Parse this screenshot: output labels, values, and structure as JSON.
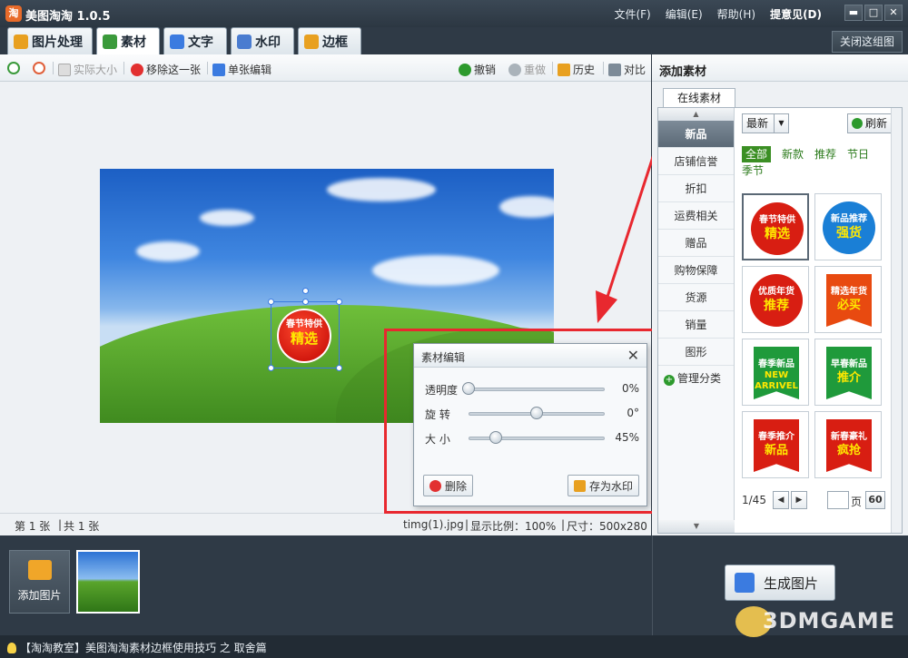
{
  "app": {
    "title": "美图淘淘 1.0.5",
    "icon_char": "淘",
    "menu": [
      "文件(F)",
      "编辑(E)",
      "帮助(H)",
      "提意见(D)"
    ],
    "window_buttons": [
      "▬",
      "□",
      "✕"
    ]
  },
  "tabs": [
    {
      "label": "图片处理",
      "icon_color": "#e8a020"
    },
    {
      "label": "素材",
      "icon_color": "#3b9a3b"
    },
    {
      "label": "文字",
      "icon_color": "#3b7be0"
    },
    {
      "label": "水印",
      "icon_color": "#4a7cd0"
    },
    {
      "label": "边框",
      "icon_color": "#e8a020"
    }
  ],
  "close_group": "关闭这组图",
  "toolbar": {
    "actual_size": "实际大小",
    "remove_one": "移除这一张",
    "single_edit": "单张编辑",
    "undo": "撤销",
    "redo": "重做",
    "history": "历史",
    "compare": "对比"
  },
  "canvas_badge": {
    "top": "春节特供",
    "bottom": "精选"
  },
  "dialog": {
    "title": "素材编辑",
    "close": "✕",
    "sliders": [
      {
        "label": "透明度",
        "value": "0%",
        "level": 0
      },
      {
        "label": "旋 转",
        "value": "0°",
        "level": 0.5
      },
      {
        "label": "大 小",
        "value": "45%",
        "level": 0.2
      }
    ],
    "delete_label": "删除",
    "save_watermark_label": "存为水印"
  },
  "status": {
    "page": "第 1 张",
    "total": "共 1 张",
    "filename": "timg(1).jpg",
    "scale": "显示比例：100%",
    "size": "尺寸：500x280"
  },
  "right_panel": {
    "title": "添加素材",
    "tab": "在线素材",
    "categories": [
      "新品",
      "店铺信誉",
      "折扣",
      "运费相关",
      "赠品",
      "购物保障",
      "货源",
      "销量",
      "图形"
    ],
    "manage": "管理分类",
    "sort": "最新",
    "refresh": "刷新",
    "filters": [
      "全部",
      "新款",
      "推荐",
      "节日",
      "季节"
    ],
    "stickers": [
      {
        "top": "春节特供",
        "bottom": "精选",
        "color": "#d81e12"
      },
      {
        "top": "新品推荐",
        "bottom": "强货",
        "color": "#1a7fd6"
      },
      {
        "top": "优质年货",
        "bottom": "推荐",
        "color": "#d81e12"
      },
      {
        "top": "精选年货",
        "bottom": "必买",
        "color": "#e84a10"
      },
      {
        "top": "春季新品",
        "bottom": "NEW ARRIVEL",
        "color": "#1f9a3b"
      },
      {
        "top": "早春新品",
        "bottom": "推介",
        "color": "#1f9a3b"
      },
      {
        "top": "春季推介",
        "bottom": "新品",
        "color": "#d81e12"
      },
      {
        "top": "新春豪礼",
        "bottom": "疯抢",
        "color": "#d81e12"
      }
    ],
    "pager": {
      "current": "1/45",
      "page_label": "页",
      "go": "60"
    }
  },
  "bottom": {
    "add_image": "添加图片",
    "generate": "生成图片"
  },
  "footer": {
    "text": "【淘淘教室】美图淘淘素材边框使用技巧 之 取舍篇"
  },
  "watermark": "3DMGAME"
}
